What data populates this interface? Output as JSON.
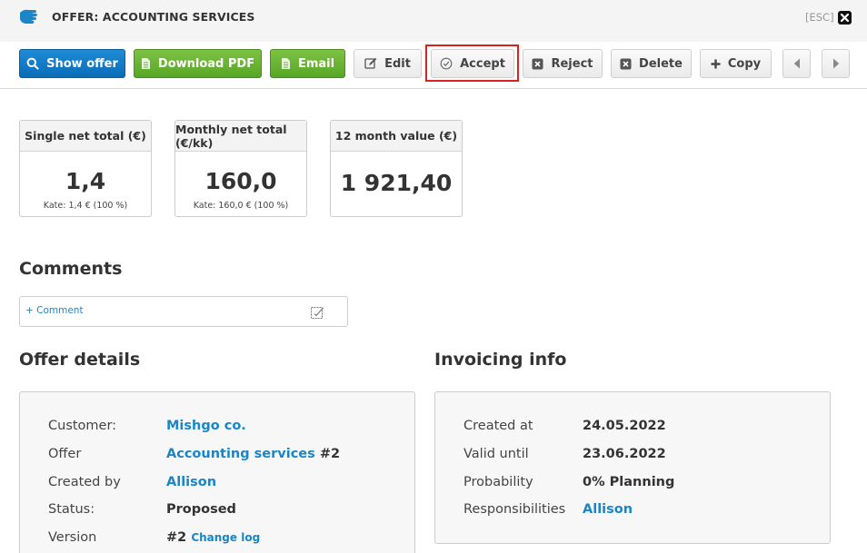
{
  "window": {
    "title": "OFFER: ACCOUNTING SERVICES",
    "esc_label": "[ESC]"
  },
  "toolbar": {
    "show_offer": "Show offer",
    "download_pdf": "Download PDF",
    "email": "Email",
    "edit": "Edit",
    "accept": "Accept",
    "reject": "Reject",
    "delete": "Delete",
    "copy": "Copy"
  },
  "summary": [
    {
      "label": "Single net total (€)",
      "value": "1,4",
      "sub": "Kate: 1,4 € (100 %)"
    },
    {
      "label": "Monthly net total (€/kk)",
      "value": "160,0",
      "sub": "Kate: 160,0 € (100 %)"
    },
    {
      "label": "12 month value (€)",
      "value": "1 921,40"
    }
  ],
  "comments": {
    "title": "Comments",
    "add_link": "+ Comment"
  },
  "offer_details": {
    "title": "Offer details",
    "customer_label": "Customer:",
    "customer_value": "Mishgo co.",
    "offer_label": "Offer",
    "offer_value": "Accounting services",
    "offer_number": "#2",
    "created_by_label": "Created by",
    "created_by_value": "Allison",
    "status_label": "Status:",
    "status_value": "Proposed",
    "version_label": "Version",
    "version_value": "#2",
    "change_log": "Change log"
  },
  "invoicing": {
    "title": "Invoicing info",
    "created_at_label": "Created at",
    "created_at_value": "24.05.2022",
    "valid_until_label": "Valid until",
    "valid_until_value": "23.06.2022",
    "probability_label": "Probability",
    "probability_value": "0% Planning",
    "responsibilities_label": "Responsibilities",
    "responsibilities_value": "Allison"
  },
  "colors": {
    "primary_blue": "#1a86c8",
    "action_green": "#6cb535",
    "highlight_red": "#d9231f"
  }
}
